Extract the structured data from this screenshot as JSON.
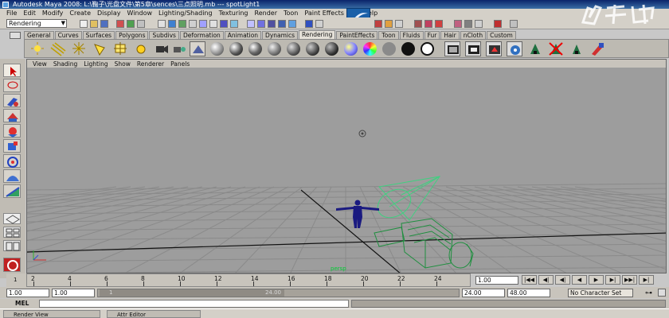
{
  "window": {
    "title": "Autodesk Maya 2008: L:\\鞠子\\光盘文件\\第5章\\sences\\三点照明.mb  ---  spotLight1"
  },
  "menubar": {
    "items": [
      "File",
      "Edit",
      "Modify",
      "Create",
      "Display",
      "Window",
      "Lighting/Shading",
      "Texturing",
      "Render",
      "Toon",
      "Paint Effects",
      "Help"
    ]
  },
  "statusline": {
    "mode": "Rendering"
  },
  "shelf": {
    "tabs": [
      "General",
      "Curves",
      "Surfaces",
      "Polygons",
      "Subdivs",
      "Deformation",
      "Animation",
      "Dynamics",
      "Rendering",
      "PaintEffects",
      "Toon",
      "Fluids",
      "Fur",
      "Hair",
      "nCloth",
      "Custom"
    ],
    "active_tab": "Rendering"
  },
  "viewport": {
    "menu": [
      "View",
      "Shading",
      "Lighting",
      "Show",
      "Renderer",
      "Panels"
    ],
    "camera_label": "persp"
  },
  "timeslider": {
    "ticks": [
      "2",
      "4",
      "6",
      "8",
      "10",
      "12",
      "14",
      "16",
      "18",
      "20",
      "22",
      "24"
    ],
    "first_frame_marker": "1",
    "current_frame": "1.00"
  },
  "playback": {
    "buttons": [
      "|◀◀",
      "◀|",
      "◀|",
      "◀",
      "▶",
      "▶|",
      "▶▶|",
      "▶|"
    ]
  },
  "range": {
    "start_time": "1.00",
    "playback_start": "1.00",
    "handle_start": "1",
    "handle_end": "24.00",
    "playback_end": "24.00",
    "end_time": "48.00",
    "character_set": "No Character Set"
  },
  "cmdline": {
    "label": "MEL"
  },
  "taskbar": {
    "tasks": [
      "Render View",
      "Attr Editor"
    ]
  },
  "colors": {
    "viewport_bg": "#9d9d9d",
    "grid": "#8a8a8a",
    "grid_axis": "#111111",
    "character": "#1a1a80",
    "light": "#40d080",
    "camera_model": "#1f8f3f"
  }
}
